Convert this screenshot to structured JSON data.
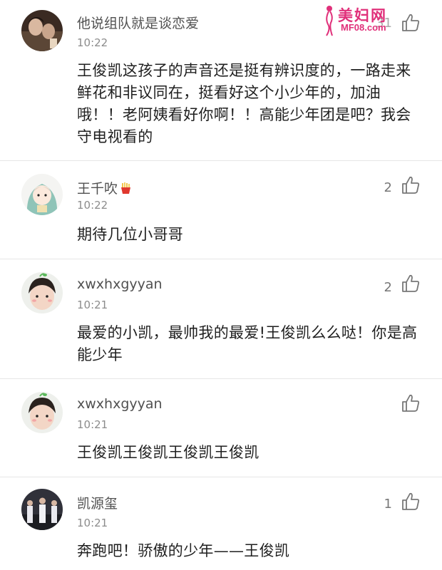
{
  "watermark": {
    "title": "美妇网",
    "subtitle": "MF08.com"
  },
  "comments": [
    {
      "username": "他说组队就是谈恋爱",
      "time": "10:22",
      "likes": "31",
      "text": "王俊凯这孩子的声音还是挺有辨识度的，一路走来鲜花和非议同在，挺看好这个小少年的，加油哦！！老阿姨看好你啊！！高能少年团是吧？我会守电视看的"
    },
    {
      "username": "王千吹",
      "time": "10:22",
      "likes": "2",
      "text": "期待几位小哥哥"
    },
    {
      "username": "xwxhxgyyan",
      "time": "10:21",
      "likes": "2",
      "text": "最爱的小凯，最帅我的最爱!王俊凯么么哒！你是高能少年"
    },
    {
      "username": "xwxhxgyyan",
      "time": "10:21",
      "likes": "",
      "text": "王俊凯王俊凯王俊凯王俊凯"
    },
    {
      "username": "凯源玺",
      "time": "10:21",
      "likes": "1",
      "text": "奔跑吧！骄傲的少年——王俊凯"
    }
  ],
  "icons": {
    "like": "thumbs-up-icon",
    "fries_emoji": "french-fries-icon"
  },
  "colors": {
    "watermark": "#e0307a",
    "divider": "#e6e6e6",
    "username": "#505050",
    "time": "#8c8c8c"
  }
}
